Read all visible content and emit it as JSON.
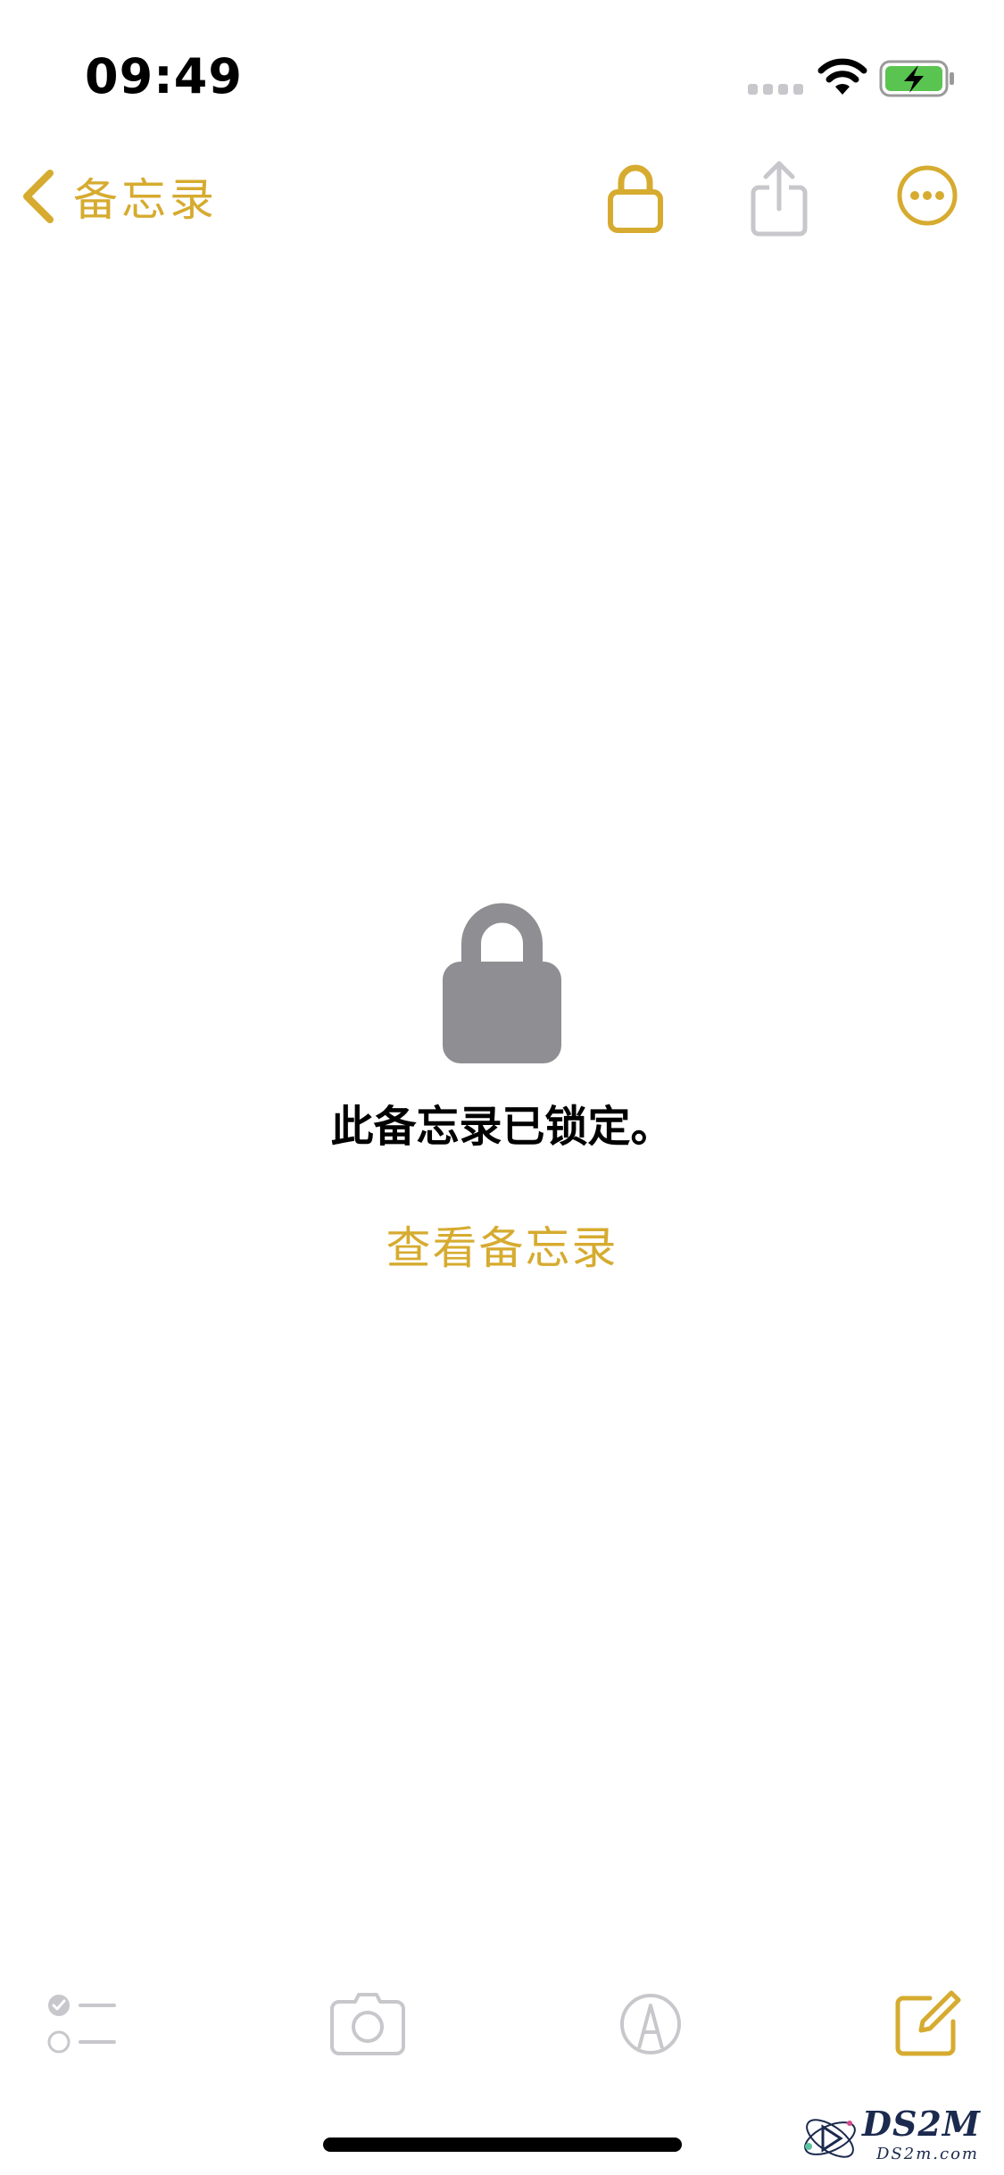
{
  "status_bar": {
    "time": "09:49"
  },
  "nav": {
    "back_label": "备忘录",
    "icons": {
      "back": "chevron-left-icon",
      "lock": "lock-icon",
      "share": "share-icon",
      "more": "ellipsis-circle-icon"
    }
  },
  "content": {
    "locked_message": "此备忘录已锁定。",
    "view_note_label": "查看备忘录"
  },
  "toolbar": {
    "icons": [
      "checklist-icon",
      "camera-icon",
      "markup-icon",
      "compose-icon"
    ]
  },
  "watermark": {
    "text": "DS2M",
    "sub": "DS2m.com"
  },
  "colors": {
    "accent": "#d6ab2f",
    "lock_gray": "#8e8e93",
    "disabled_gray": "#c7c7cc",
    "battery_green": "#5ac451"
  }
}
